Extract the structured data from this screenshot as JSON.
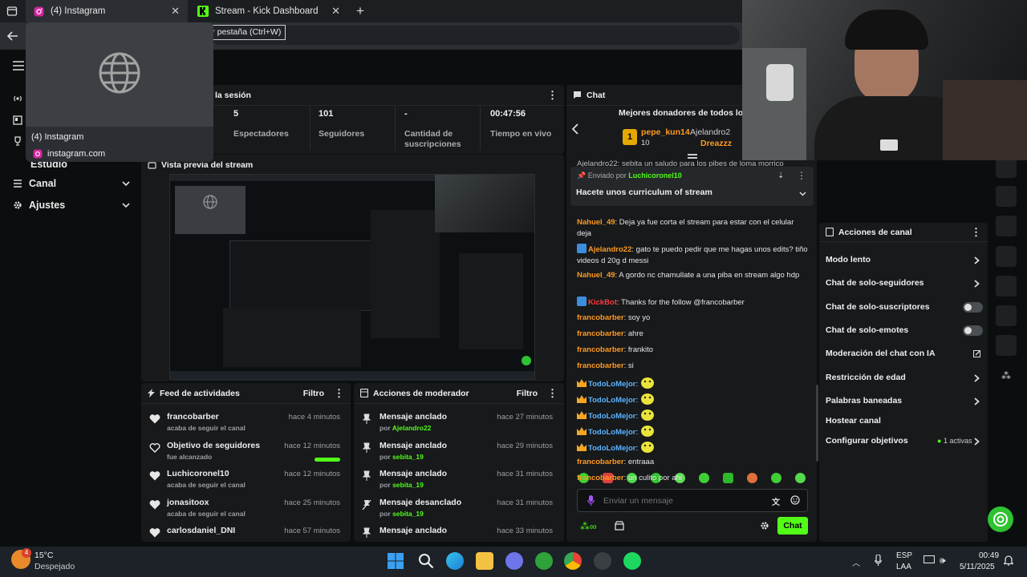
{
  "browser": {
    "tabs": [
      {
        "label": "(4) Instagram",
        "active": true
      },
      {
        "label": "Stream - Kick Dashboard",
        "active": false
      }
    ],
    "tooltip": "Cerrar pestaña (Ctrl+W)",
    "hover_card": {
      "title": "(4) Instagram",
      "url": "instagram.com"
    }
  },
  "sidebar": {
    "partial_item": "Estudio",
    "items": [
      {
        "label": "Canal"
      },
      {
        "label": "Ajustes"
      }
    ]
  },
  "session": {
    "title_partial": "la sesión",
    "stats": [
      {
        "value": "5",
        "label": "Espectadores"
      },
      {
        "value": "101",
        "label": "Seguidores"
      },
      {
        "value": "-",
        "label": "Cantidad de suscripciones"
      },
      {
        "value": "00:47:56",
        "label": "Tiempo en vivo"
      }
    ]
  },
  "preview": {
    "title": "Vista previa del stream"
  },
  "feed": {
    "title": "Feed de actividades",
    "filter": "Filtro",
    "items": [
      {
        "user": "francobarber",
        "sub": "acaba de seguir el canal",
        "time": "hace 4 minutos",
        "icon": "heart-icon"
      },
      {
        "user": "Objetivo de seguidores",
        "sub": "fue alcanzado",
        "time": "hace 12 minutos",
        "icon": "heart-outline-icon",
        "progress": 1.0
      },
      {
        "user": "Luchicoronel10",
        "sub": "acaba de seguir el canal",
        "time": "hace 12 minutos",
        "icon": "heart-icon"
      },
      {
        "user": "jonasitoox",
        "sub": "acaba de seguir el canal",
        "time": "hace 25 minutos",
        "icon": "heart-icon"
      },
      {
        "user": "carlosdaniel_DNI",
        "sub": "",
        "time": "hace 57 minutos",
        "icon": "heart-icon"
      }
    ]
  },
  "mod": {
    "title": "Acciones de moderador",
    "filter": "Filtro",
    "items": [
      {
        "action": "Mensaje anclado",
        "by": "por",
        "user": "Ajelandro22",
        "time": "hace 27 minutos",
        "icon": "pin-icon"
      },
      {
        "action": "Mensaje anclado",
        "by": "por",
        "user": "sebita_19",
        "time": "hace 29 minutos",
        "icon": "pin-icon"
      },
      {
        "action": "Mensaje anclado",
        "by": "por",
        "user": "sebita_19",
        "time": "hace 31 minutos",
        "icon": "pin-icon"
      },
      {
        "action": "Mensaje desanclado",
        "by": "por",
        "user": "sebita_19",
        "time": "hace 31 minutos",
        "icon": "unpin-icon"
      },
      {
        "action": "Mensaje anclado",
        "by": "",
        "user": "",
        "time": "hace 33 minutos",
        "icon": "pin-icon"
      }
    ]
  },
  "chat": {
    "title": "Chat",
    "donors_title": "Mejores donadores de todos los ti",
    "donors": [
      {
        "rank": "1",
        "name": "pepe_kun14",
        "amount": "10"
      },
      {
        "name": "Ajelandro2"
      },
      {
        "name": "Dreazzz"
      }
    ],
    "partial_top": "Ajelandro22: sebita un saludo para los pibes de loma morrico",
    "pinned": {
      "by_label": "Enviado por",
      "by_user": "Luchicoronel10",
      "text": "Hacete unos curriculum of stream"
    },
    "messages": [
      {
        "user": "Nahuel_49",
        "text": ": Deja ya fue corta el stream para estar con el celular deja",
        "color": "u-or"
      },
      {
        "user": "Ajelandro22",
        "text": ": gato te puedo pedir que me hagas unos edits? tiño videos d 20g d messi",
        "color": "u-or",
        "badge": true
      },
      {
        "user": "Nahuel_49",
        "text": ": A gordo nc chamullate a una piba en stream algo hdp",
        "color": "u-or"
      },
      {
        "user": "KickBot",
        "text": ": Thanks for the follow @francobarber",
        "color": "u-rd",
        "badge": true
      },
      {
        "user": "francobarber",
        "text": ": soy yo",
        "color": "u-or"
      },
      {
        "user": "francobarber",
        "text": ": ahre",
        "color": "u-or"
      },
      {
        "user": "francobarber",
        "text": ": frankito",
        "color": "u-or"
      },
      {
        "user": "francobarber",
        "text": ": si",
        "color": "u-or"
      },
      {
        "user": "TodoLoMejor",
        "text": ":",
        "color": "u-bl",
        "emote": true
      },
      {
        "user": "TodoLoMejor",
        "text": ":",
        "color": "u-bl",
        "emote": true
      },
      {
        "user": "TodoLoMejor",
        "text": ":",
        "color": "u-bl",
        "emote": true
      },
      {
        "user": "TodoLoMejor",
        "text": ":",
        "color": "u-bl",
        "emote": true
      },
      {
        "user": "TodoLoMejor",
        "text": ":",
        "color": "u-bl",
        "emote": true
      },
      {
        "user": "francobarber",
        "text": ": entraaa",
        "color": "u-or"
      },
      {
        "user": "francobarber",
        "text": ": un culito por ahi",
        "color": "u-or"
      }
    ],
    "input_placeholder": "Enviar un mensaje",
    "send_label": "Chat"
  },
  "channel_actions": {
    "title": "Acciones de canal",
    "items": [
      {
        "label": "Modo lento",
        "control": "chevron"
      },
      {
        "label": "Chat de solo-seguidores",
        "control": "chevron"
      },
      {
        "label": "Chat de solo-suscriptores",
        "control": "toggle",
        "on": false
      },
      {
        "label": "Chat de solo-emotes",
        "control": "toggle",
        "on": false
      },
      {
        "label": "Moderación del chat con IA",
        "control": "external"
      },
      {
        "label": "Restricción de edad",
        "control": "chevron"
      },
      {
        "label": "Palabras baneadas",
        "control": "chevron"
      },
      {
        "label": "Hostear canal",
        "control": "none"
      },
      {
        "label": "Configurar objetivos",
        "control": "chevron",
        "extra": "1 activas"
      }
    ]
  },
  "taskbar": {
    "weather_temp": "15°C",
    "weather_desc": "Despejado",
    "badge": "4",
    "lang1": "ESP",
    "lang2": "LAA",
    "time": "00:49",
    "date": "5/11/2025"
  },
  "colors": {
    "accent": "#53fc18",
    "bg": "#0b0e0f",
    "panel": "#17191b"
  }
}
